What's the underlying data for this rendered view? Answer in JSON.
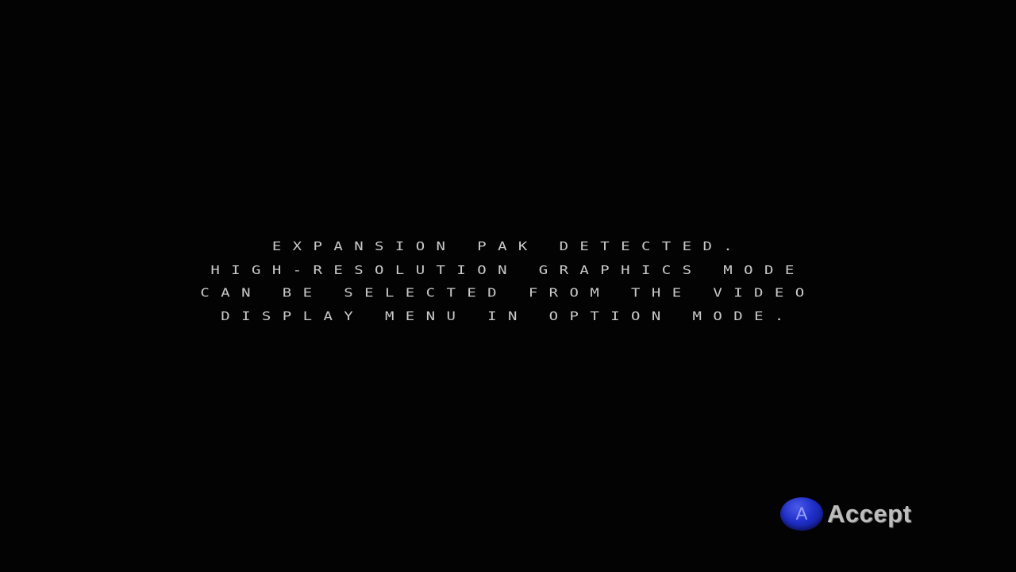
{
  "message": {
    "lines": [
      "EXPANSION PAK DETECTED.",
      "HIGH-RESOLUTION GRAPHICS MODE",
      "CAN BE SELECTED FROM THE VIDEO",
      "DISPLAY MENU IN OPTION MODE."
    ]
  },
  "prompt": {
    "button_letter": "A",
    "button_icon": "a-button-icon",
    "label": "Accept",
    "button_color": "#1f2fc8"
  }
}
